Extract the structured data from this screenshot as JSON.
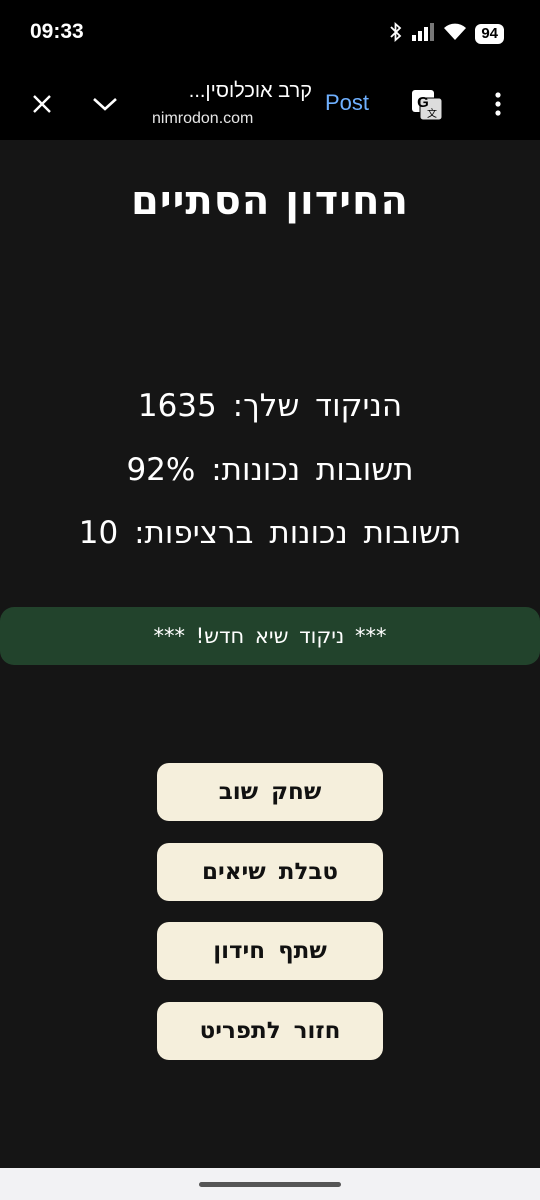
{
  "status_bar": {
    "time": "09:33",
    "battery": "94",
    "icons": [
      "bluetooth-icon",
      "signal-icon",
      "wifi-icon",
      "battery-icon"
    ]
  },
  "browser_toolbar": {
    "page_title": "קרב אוכלוסין...",
    "url": "nimrodon.com",
    "post_label": "Post",
    "accent_color": "#6fb0ff",
    "icons": [
      "close-icon",
      "chevron-down-icon",
      "translate-icon",
      "more-vert-icon"
    ]
  },
  "game": {
    "title": "החידון הסתיים",
    "stats": [
      {
        "label": "הניקוד שלך:",
        "value": "1635"
      },
      {
        "label": "תשובות נכונות:",
        "value": "92%"
      },
      {
        "label": "תשובות נכונות ברציפות:",
        "value": "10"
      }
    ],
    "banner": "*** ניקוד שיא חדש! ***",
    "banner_color": "#22432c",
    "buttons": {
      "play_again": "שחק שוב",
      "leaderboard": "טבלת שיאים",
      "share": "שתף חידון",
      "back_to_menu": "חזור לתפריט"
    },
    "button_color": "#f5efdc"
  }
}
